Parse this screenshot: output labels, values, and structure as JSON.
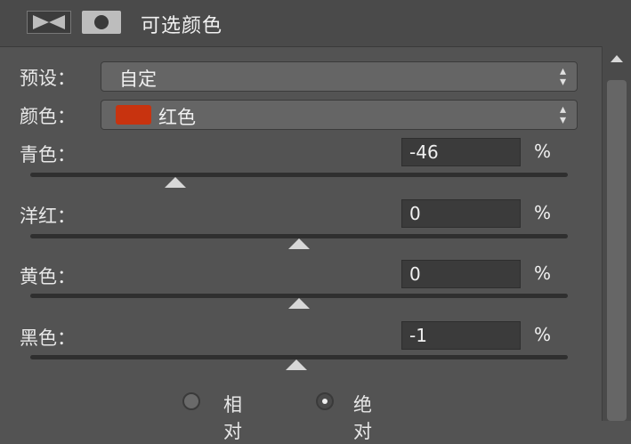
{
  "header": {
    "title": "可选颜色"
  },
  "preset": {
    "label": "预设：",
    "value": "自定"
  },
  "color": {
    "label": "颜色：",
    "value": "红色",
    "swatch": "#c8330f"
  },
  "sliders": [
    {
      "label": "青色：",
      "value": "-46",
      "unit": "%",
      "thumb": -46
    },
    {
      "label": "洋红：",
      "value": "0",
      "unit": "%",
      "thumb": 0
    },
    {
      "label": "黄色：",
      "value": "0",
      "unit": "%",
      "thumb": 0
    },
    {
      "label": "黑色：",
      "value": "-1",
      "unit": "%",
      "thumb": -1
    }
  ],
  "method": {
    "relative": "相对",
    "absolute": "绝对",
    "selected": "absolute"
  }
}
